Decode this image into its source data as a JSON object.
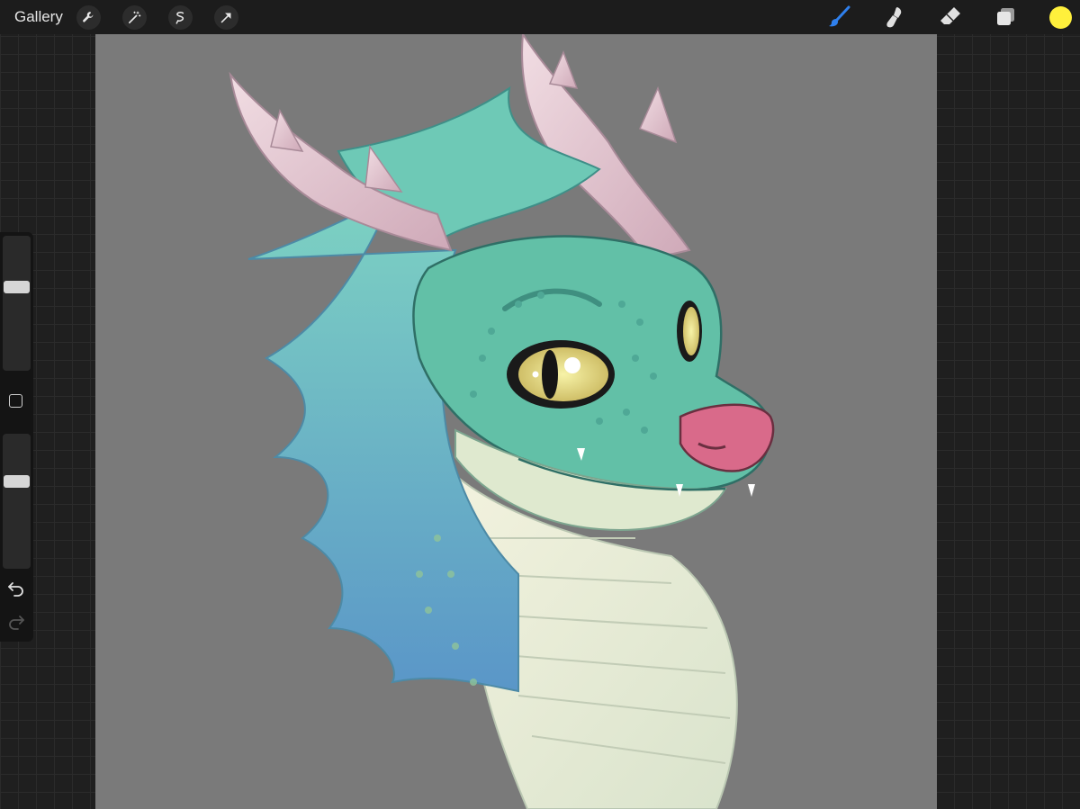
{
  "topbar": {
    "gallery_label": "Gallery",
    "left_tools": [
      "wrench-icon",
      "magic-wand-icon",
      "selection-icon",
      "transform-arrow-icon"
    ],
    "right_tools": [
      "brush-icon",
      "smudge-icon",
      "eraser-icon",
      "layers-icon"
    ],
    "active_tool": "brush",
    "current_color": "#fff03c"
  },
  "sidebar": {
    "brush_size_level": 0.63,
    "opacity_level": 0.66,
    "tools": [
      "modify-button",
      "undo-icon",
      "redo-icon"
    ]
  },
  "canvas": {
    "background_color": "#7a7a7a",
    "artwork": "dragon-head-illustration",
    "colors": {
      "scales": "#5fbfaa",
      "mane": "#6cc8b8",
      "mane_shadow": "#4f86c9",
      "horns": "#e8cdd6",
      "belly": "#eef0d8",
      "nose": "#d96a8a",
      "eye": "#e8e07a"
    }
  }
}
